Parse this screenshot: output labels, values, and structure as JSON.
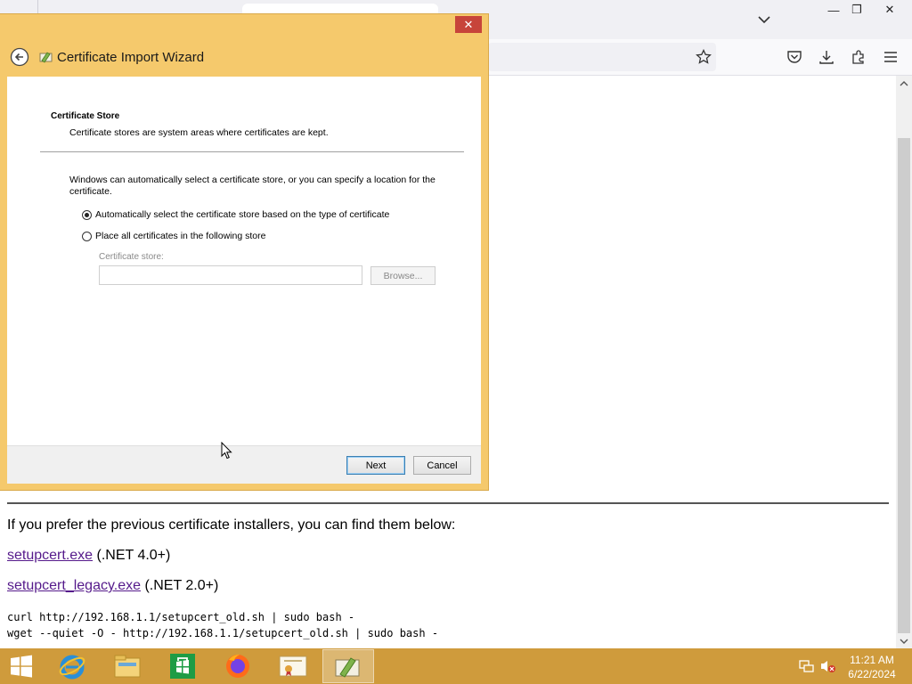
{
  "browser": {
    "window_controls": {
      "minimize": "—",
      "restore": "❐",
      "close": "✕"
    },
    "tab_list_icon": "chevron-down-icon",
    "toolbar_icons": [
      "star-icon",
      "pocket-icon",
      "download-icon",
      "extensions-icon",
      "menu-icon"
    ]
  },
  "page": {
    "intro_text": "If you prefer the previous certificate installers, you can find them below:",
    "links": [
      {
        "label": "setupcert.exe",
        "note": " (.NET 4.0+)"
      },
      {
        "label": "setupcert_legacy.exe",
        "note": " (.NET 2.0+)"
      }
    ],
    "code_lines": [
      "curl http://192.168.1.1/setupcert_old.sh | sudo bash -",
      "wget --quiet -O - http://192.168.1.1/setupcert_old.sh | sudo bash -"
    ]
  },
  "dialog": {
    "title": "Certificate Import Wizard",
    "close_label": "✕",
    "section_title": "Certificate Store",
    "section_desc": "Certificate stores are system areas where certificates are kept.",
    "info_text": "Windows can automatically select a certificate store, or you can specify a location for the certificate.",
    "options": [
      {
        "label": "Automatically select the certificate store based on the type of certificate",
        "checked": true
      },
      {
        "label": "Place all certificates in the following store",
        "checked": false
      }
    ],
    "store_label": "Certificate store:",
    "store_value": "",
    "browse_label": "Browse...",
    "next_label": "Next",
    "cancel_label": "Cancel"
  },
  "taskbar": {
    "items": [
      "start-button",
      "internet-explorer",
      "file-explorer",
      "store",
      "firefox",
      "certificate-app",
      "certificate-import-wizard"
    ],
    "clock_time": "11:21 AM",
    "clock_date": "6/22/2024",
    "colors": {
      "taskbar": "#cf9b3c",
      "dialog_frame": "#f5c96c",
      "link": "#551a8b"
    }
  }
}
